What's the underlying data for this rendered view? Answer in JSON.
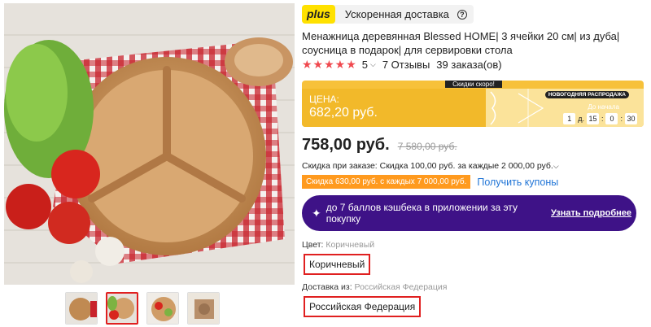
{
  "gallery": {
    "main_image": "wooden-three-section-plate-photo",
    "thumbnails": [
      "thumb-1",
      "thumb-2",
      "thumb-3",
      "thumb-4"
    ],
    "active_index": 1
  },
  "delivery": {
    "badge": "plus",
    "text": "Ускоренная доставка",
    "help_icon": "?"
  },
  "product": {
    "title": "Менажница деревянная Blessed HOME| 3 ячейки 20 см| из дуба| соусница в подарок| для сервировки стола"
  },
  "rating": {
    "stars": "★★★★★",
    "value": "5",
    "reviews": "7 Отзывы",
    "orders": "39 заказа(ов)"
  },
  "promo": {
    "top_banner": "Скидки скоро!",
    "price_label": "ЦЕНА:",
    "price": "682,20 руб.",
    "event_badge": "НОВОГОДНЯЯ РАСПРОДАЖА",
    "until_label": "До начала",
    "timer": {
      "days": "1",
      "days_unit": "д.",
      "hours": "15",
      "minutes": "0",
      "seconds": "30"
    }
  },
  "price": {
    "current": "758,00 руб.",
    "old": "7 580,00 руб."
  },
  "discounts": {
    "order_discount": "Скидка при заказе: Скидка 100,00 руб. за каждые 2 000,00 руб.",
    "coupon_tag": "Скидка 630,00 руб. с каждых 7 000,00 руб.",
    "coupon_link": "Получить купоны"
  },
  "cashback": {
    "text": "до 7 баллов кэшбека в приложении за эту покупку",
    "link": "Узнать подробнее"
  },
  "options": {
    "color_label": "Цвет:",
    "color_value": "Коричневый",
    "color_selected": "Коричневый",
    "ship_label": "Доставка из:",
    "ship_value": "Российская Федерация",
    "ship_selected": "Российская Федерация"
  },
  "colors": {
    "accent_red": "#e02020",
    "star_red": "#f0484e",
    "promo_yellow": "#f7c13a",
    "cashback_purple": "#3e1287",
    "coupon_orange": "#ff9a1e",
    "link_blue": "#1f74d6",
    "plus_yellow": "#ffe100"
  }
}
